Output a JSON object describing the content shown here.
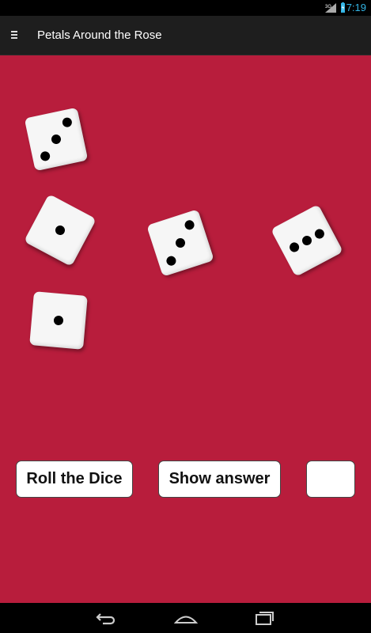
{
  "status_bar": {
    "time": "7:19",
    "signal_icon": "signal-3g-icon",
    "battery_icon": "battery-charging-icon",
    "accent": "#33b5e5"
  },
  "action_bar": {
    "title": "Petals Around the Rose",
    "menu_icon": "drawer-menu-icon"
  },
  "board": {
    "background": "#b81d3c",
    "dice": [
      {
        "value": 3
      },
      {
        "value": 1
      },
      {
        "value": 3
      },
      {
        "value": 3
      },
      {
        "value": 1
      }
    ]
  },
  "controls": {
    "roll_label": "Roll the Dice",
    "show_label": "Show answer",
    "answer_value": ""
  },
  "nav_bar": {
    "back_icon": "back-icon",
    "home_icon": "home-icon",
    "recents_icon": "recent-apps-icon"
  }
}
